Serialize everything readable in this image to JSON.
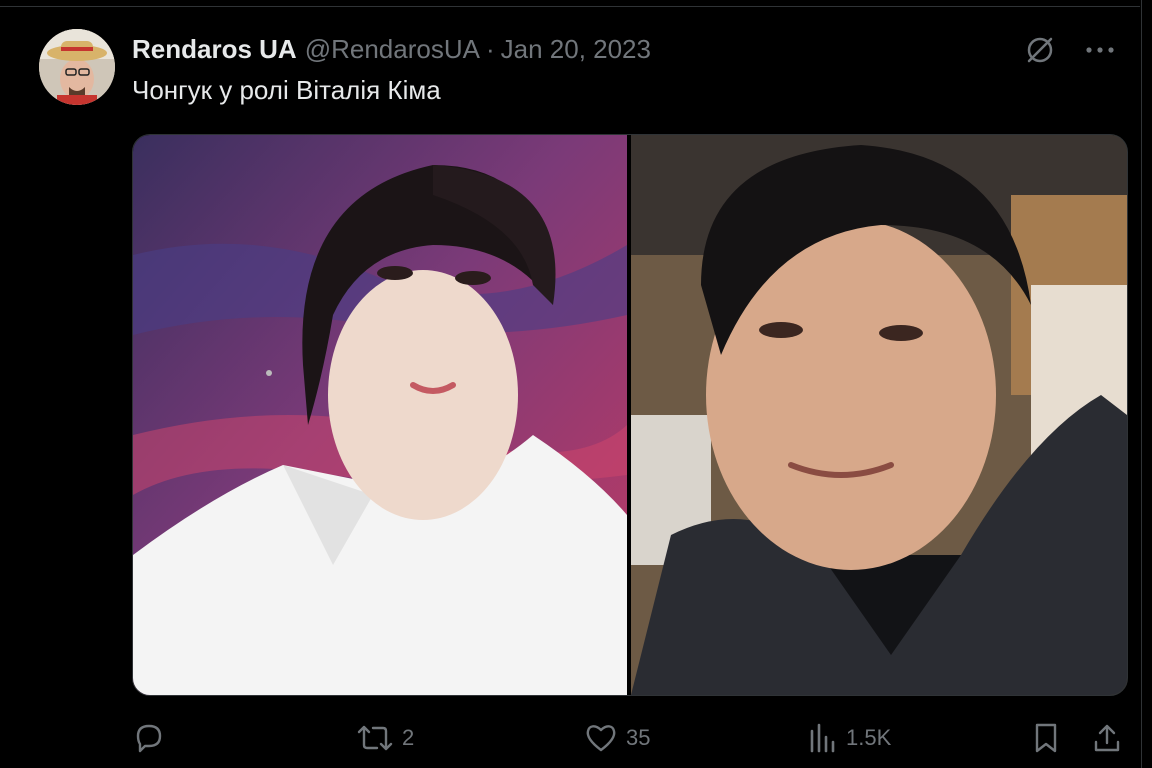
{
  "tweet": {
    "display_name": "Rendaros UA",
    "handle": "@RendarosUA",
    "separator": "·",
    "date": "Jan 20, 2023",
    "text": "Чонгук у ролі Віталія Кіма"
  },
  "header_icons": [
    "grok-icon",
    "more-icon"
  ],
  "media": {
    "count": 2
  },
  "actions": {
    "reply_count": "",
    "retweet_count": "2",
    "like_count": "35",
    "views_count": "1.5K"
  },
  "colors": {
    "background": "#000000",
    "text": "#e7e9ea",
    "muted": "#71767b",
    "border": "#2f3336"
  }
}
